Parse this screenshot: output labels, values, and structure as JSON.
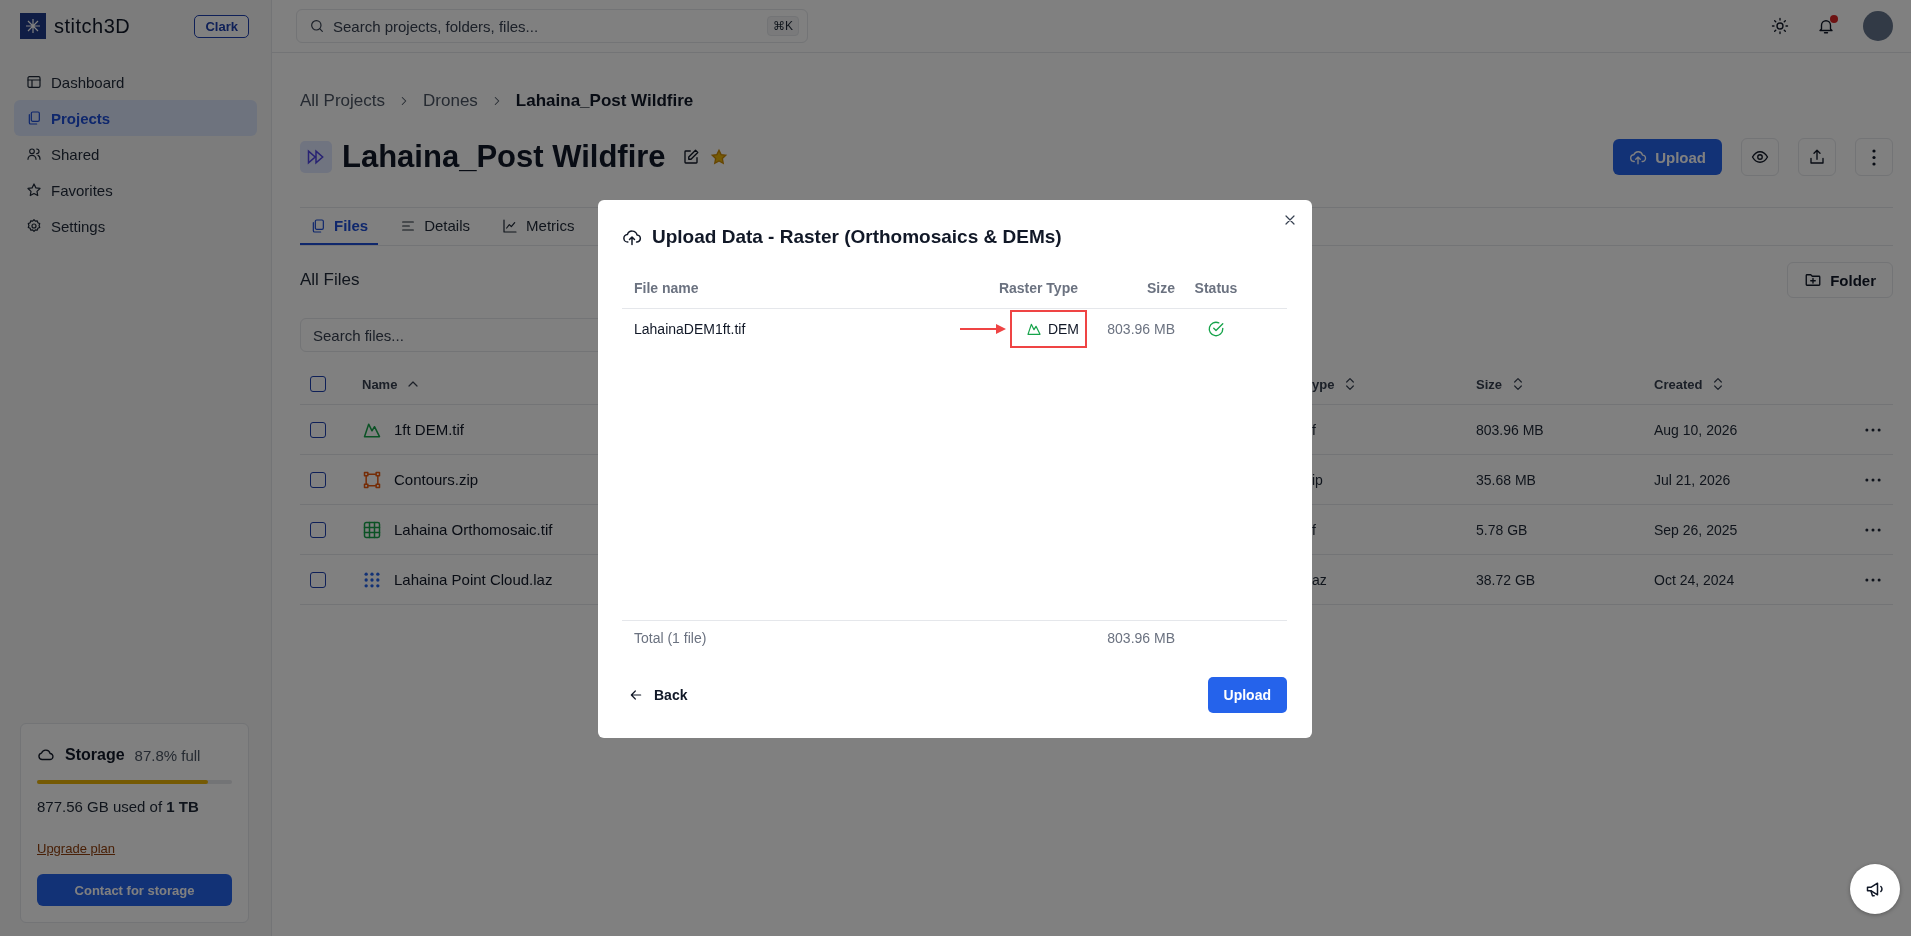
{
  "app": {
    "logo_text": "stitch3D",
    "org_badge": "Clark"
  },
  "sidebar": {
    "items": [
      {
        "label": "Dashboard",
        "selected": false
      },
      {
        "label": "Projects",
        "selected": true
      },
      {
        "label": "Shared",
        "selected": false
      },
      {
        "label": "Favorites",
        "selected": false
      },
      {
        "label": "Settings",
        "selected": false
      }
    ],
    "storage": {
      "title": "Storage",
      "percent_text": "87.8% full",
      "level": 0.878,
      "used_text": "877.56 GB used of **1 TB**",
      "upgrade_link": "Upgrade plan",
      "contact_button": "Contact for storage"
    }
  },
  "search": {
    "placeholder": "Search projects, folders, files...",
    "shortcut": "⌘K"
  },
  "topbar": {
    "has_notifications": true
  },
  "breadcrumb": [
    "All Projects",
    "Drones",
    "Lahaina_Post Wildfire"
  ],
  "project": {
    "title": "Lahaina_Post Wildfire",
    "favorite": true,
    "upload_button": "Upload"
  },
  "tabs": [
    {
      "label": "Files",
      "selected": true
    },
    {
      "label": "Details",
      "selected": false
    },
    {
      "label": "Metrics",
      "selected": false
    }
  ],
  "files": {
    "heading": "All Files",
    "folder_button": "Folder",
    "search_placeholder": "Search files...",
    "all_checked": false,
    "columns": [
      {
        "label": "Name",
        "sorted": true
      },
      {
        "label": "ype",
        "sorted": false
      },
      {
        "label": "Size",
        "sorted": false
      },
      {
        "label": "Created",
        "sorted": false
      }
    ],
    "rows": [
      {
        "name": "1ft DEM.tif",
        "kind": "dem",
        "type": "f",
        "size": "803.96 MB",
        "created": "Aug 10, 2026",
        "checked": false
      },
      {
        "name": "Contours.zip",
        "kind": "vector",
        "type": "ip",
        "size": "35.68 MB",
        "created": "Jul 21, 2026",
        "checked": false
      },
      {
        "name": "Lahaina Orthomosaic.tif",
        "kind": "ortho",
        "type": "f",
        "size": "5.78 GB",
        "created": "Sep 26, 2025",
        "checked": false
      },
      {
        "name": "Lahaina Point Cloud.laz",
        "kind": "pointcloud",
        "type": "az",
        "size": "38.72 GB",
        "created": "Oct 24, 2024",
        "checked": false
      }
    ]
  },
  "modal": {
    "title": "Upload Data - Raster (Orthomosaics & DEMs)",
    "columns": [
      "File name",
      "Raster Type",
      "Size",
      "Status"
    ],
    "rows": [
      {
        "file_name": "LahainaDEM1ft.tif",
        "raster_type": "DEM",
        "highlighted": true,
        "size": "803.96 MB",
        "uploaded": true
      }
    ],
    "total_label": "Total (1 file)",
    "total_size": "803.96 MB",
    "back_button": "Back",
    "upload_button": "Upload"
  }
}
